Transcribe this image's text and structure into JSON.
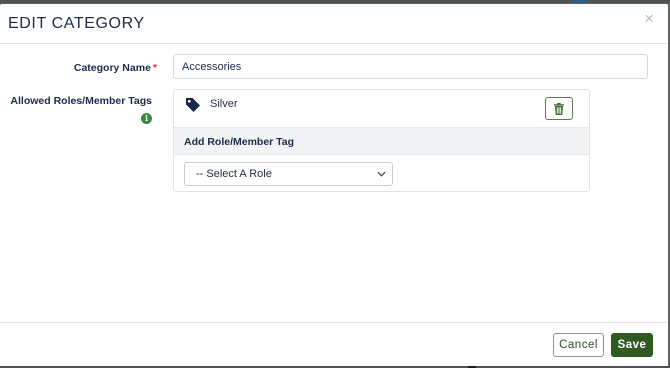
{
  "modal": {
    "title": "EDIT CATEGORY",
    "close_glyph": "×"
  },
  "form": {
    "category_name_label": "Category Name",
    "required_mark": "*",
    "category_name_value": "Accessories",
    "roles_label": "Allowed Roles/Member Tags",
    "info_glyph": "i"
  },
  "roles": {
    "items": [
      {
        "label": "Silver",
        "icon": "tag-icon"
      }
    ],
    "delete_icon": "trash-icon",
    "add_title": "Add Role/Member Tag",
    "select": {
      "selected": "-- Select A Role",
      "icon": "chevron-down-icon"
    }
  },
  "footer": {
    "cancel_label": "Cancel",
    "save_label": "Save"
  },
  "colors": {
    "primary": "#2f5a22",
    "required": "#d9342b",
    "info": "#3a8a3d",
    "text": "#1c2b4a",
    "backdrop": "#5f6361"
  }
}
